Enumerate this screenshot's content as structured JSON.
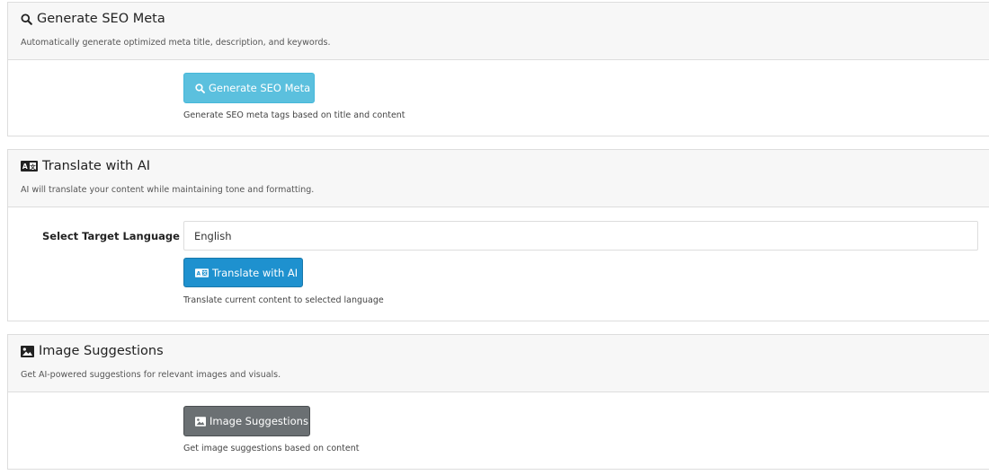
{
  "sections": {
    "seo": {
      "icon": "search-icon",
      "title": "Generate SEO Meta",
      "description": "Automatically generate optimized meta title, description, and keywords.",
      "button_label": "Generate SEO Meta",
      "help_text": "Generate SEO meta tags based on title and content",
      "button_color": "#5bc0de"
    },
    "translate": {
      "icon": "translate-icon",
      "title": "Translate with AI",
      "description": "AI will translate your content while maintaining tone and formatting.",
      "field_label": "Select Target Language",
      "selected_language": "English",
      "button_label": "Translate with AI",
      "help_text": "Translate current content to selected language",
      "button_color": "#1e91cf"
    },
    "images": {
      "icon": "image-icon",
      "title": "Image Suggestions",
      "description": "Get AI-powered suggestions for relevant images and visuals.",
      "button_label": "Image Suggestions",
      "help_text": "Get image suggestions based on content",
      "button_color": "#6b7073"
    }
  }
}
